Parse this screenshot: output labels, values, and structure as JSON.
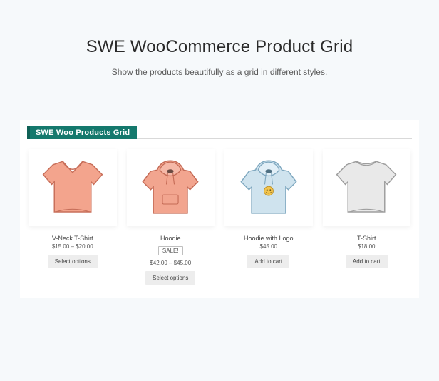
{
  "hero": {
    "title": "SWE WooCommerce Product Grid",
    "subtitle": "Show  the products beautifully as a grid in different styles."
  },
  "panel": {
    "heading": "SWE Woo Products Grid"
  },
  "products": [
    {
      "name": "V-Neck T-Shirt",
      "price": "$15.00 – $20.00",
      "sale": "",
      "cta": "Select options"
    },
    {
      "name": "Hoodie",
      "price": "$42.00 – $45.00",
      "sale": "SALE!",
      "cta": "Select options"
    },
    {
      "name": "Hoodie with Logo",
      "price": "$45.00",
      "sale": "",
      "cta": "Add to cart"
    },
    {
      "name": "T-Shirt",
      "price": "$18.00",
      "sale": "",
      "cta": "Add to cart"
    }
  ]
}
